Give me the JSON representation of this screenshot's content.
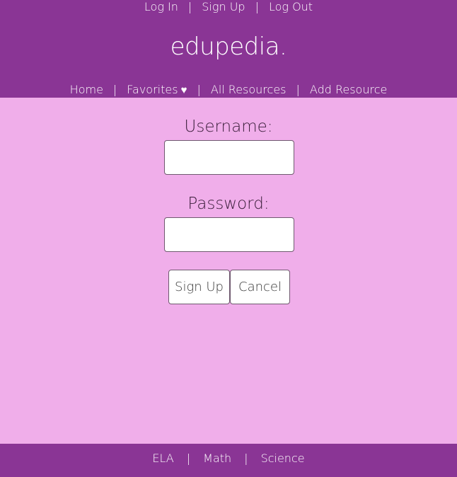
{
  "header": {
    "top_links": {
      "login": "Log In",
      "signup": "Sign Up",
      "logout": "Log Out",
      "separator": "|"
    },
    "brand": "edupedia.",
    "nav": {
      "home": "Home",
      "favorites": "Favorites",
      "favorites_icon": "heart-icon",
      "all_resources": "All Resources",
      "add_resource": "Add Resource",
      "separator": "|"
    }
  },
  "form": {
    "username_label": "Username:",
    "username_value": "",
    "password_label": "Password:",
    "password_value": "",
    "signup_button": "Sign Up",
    "cancel_button": "Cancel"
  },
  "footer": {
    "ela": "ELA",
    "math": "Math",
    "science": "Science",
    "separator": "|"
  },
  "colors": {
    "header_bg": "#8a3595",
    "body_bg": "#f0aeea",
    "text_light": "#ffffff"
  }
}
